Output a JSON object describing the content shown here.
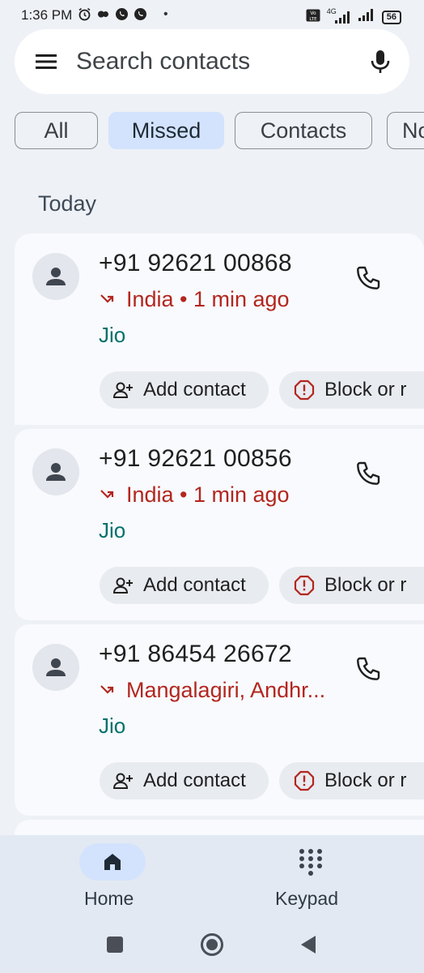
{
  "status_bar": {
    "time": "1:36 PM",
    "separator": "•",
    "network": "4G",
    "battery": "56"
  },
  "search": {
    "placeholder": "Search contacts",
    "menu_icon": "hamburger-menu-icon",
    "mic_icon": "microphone-icon"
  },
  "filters": [
    {
      "label": "All",
      "selected": false
    },
    {
      "label": "Missed",
      "selected": true
    },
    {
      "label": "Contacts",
      "selected": false
    },
    {
      "label": "No",
      "selected": false
    }
  ],
  "section_heading": "Today",
  "calls": [
    {
      "number": "+91 92621 00868",
      "detail": "India • 1 min ago",
      "carrier": "Jio",
      "add_label": "Add contact",
      "block_label": "Block or r"
    },
    {
      "number": "+91 92621 00856",
      "detail": "India • 1 min ago",
      "carrier": "Jio",
      "add_label": "Add contact",
      "block_label": "Block or r"
    },
    {
      "number": "+91 86454 26672",
      "detail": "Mangalagiri, Andhr...",
      "carrier": "Jio",
      "add_label": "Add contact",
      "block_label": "Block or r"
    }
  ],
  "bottom_nav": {
    "home_label": "Home",
    "keypad_label": "Keypad"
  },
  "colors": {
    "missed": "#b3261e",
    "carrier": "#00706b",
    "selected_chip": "#d3e3fd",
    "background": "#eef1f6"
  }
}
